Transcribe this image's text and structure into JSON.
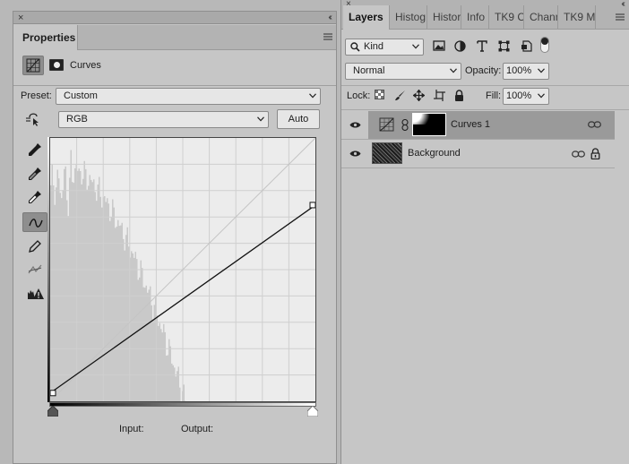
{
  "properties": {
    "tab": "Properties",
    "adjustment_title": "Curves",
    "preset_label": "Preset:",
    "preset_value": "Custom",
    "channel_value": "RGB",
    "auto_label": "Auto",
    "input_label": "Input:",
    "output_label": "Output:",
    "tools": [
      "sample-black-point-icon",
      "sample-gray-point-icon",
      "sample-white-point-icon",
      "curve-point-icon",
      "pencil-icon",
      "smooth-curve-icon",
      "clipping-warning-icon"
    ],
    "curve_points": [
      {
        "input": 0,
        "output": 8
      },
      {
        "input": 255,
        "output": 190
      }
    ]
  },
  "layers": {
    "tabs": [
      "Layers",
      "Histog",
      "Histor",
      "Info",
      "TK9 C",
      "Chann",
      "TK9 M"
    ],
    "filter_kind": "Kind",
    "blend_mode": "Normal",
    "opacity_label": "Opacity:",
    "opacity_value": "100%",
    "lock_label": "Lock:",
    "fill_label": "Fill:",
    "fill_value": "100%",
    "items": [
      {
        "name": "Curves 1",
        "selected": true
      },
      {
        "name": "Background",
        "selected": false
      }
    ]
  }
}
